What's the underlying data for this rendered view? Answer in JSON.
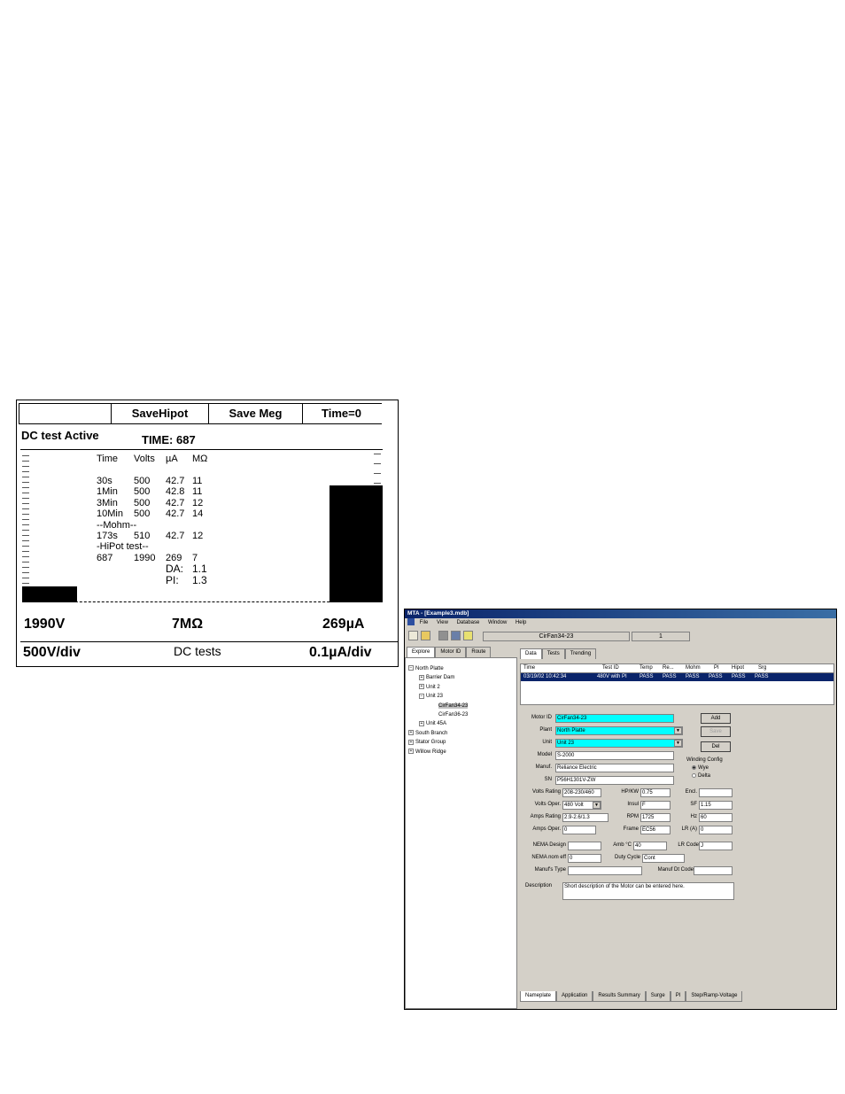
{
  "instrument": {
    "softkeys": [
      "",
      "SaveHipot",
      "Save Meg",
      "Time=0"
    ],
    "status": "DC test Active",
    "time_label": "TIME: 687",
    "columns": [
      "Time",
      "Volts",
      "µA",
      "MΩ"
    ],
    "rows": [
      [
        "30s",
        "500",
        "42.7",
        "11"
      ],
      [
        "1Min",
        "500",
        "42.8",
        "11"
      ],
      [
        "3Min",
        "500",
        "42.7",
        "12"
      ],
      [
        "10Min",
        "500",
        "42.7",
        "14"
      ],
      [
        "--Mohm--",
        "",
        "",
        ""
      ],
      [
        "173s",
        "510",
        "42.7",
        "12"
      ],
      [
        "-HiPot test--",
        "",
        "",
        ""
      ],
      [
        "687",
        "1990",
        "269",
        "7"
      ],
      [
        "",
        "",
        "DA:",
        "1.1"
      ],
      [
        "",
        "",
        "PI:",
        "1.3"
      ]
    ],
    "readout_voltage": "1990V",
    "readout_resistance": "7MΩ",
    "readout_current": "269µA",
    "scale_voltage": "500V/div",
    "mode": "DC tests",
    "scale_current": "0.1µA/div"
  },
  "mta": {
    "title": "MTA - [Example3.mdb]",
    "menu": [
      "File",
      "View",
      "Database",
      "Window",
      "Help"
    ],
    "toolbar_motor": "CirFan34-23",
    "toolbar_index": "1",
    "left_tabs": [
      "Explore",
      "Motor ID",
      "Route"
    ],
    "tree": [
      {
        "label": "North Platte",
        "indent": 0,
        "exp": "-"
      },
      {
        "label": "Barrier Dam",
        "indent": 1,
        "exp": "+"
      },
      {
        "label": "Unit 2",
        "indent": 1,
        "exp": "+"
      },
      {
        "label": "Unit 23",
        "indent": 1,
        "exp": "-"
      },
      {
        "label": "CirFan34-23",
        "indent": 3,
        "exp": ""
      },
      {
        "label": "CirFan36-23",
        "indent": 3,
        "exp": ""
      },
      {
        "label": "Unit 45A",
        "indent": 1,
        "exp": "+"
      },
      {
        "label": "South Branch",
        "indent": 0,
        "exp": "+"
      },
      {
        "label": "Stator Group",
        "indent": 0,
        "exp": "+"
      },
      {
        "label": "Willow Ridge",
        "indent": 0,
        "exp": "+"
      }
    ],
    "right_tabs": [
      "Data",
      "Tests",
      "Trending"
    ],
    "grid_headers": [
      "Time",
      "Test ID",
      "Temp",
      "Re...",
      "Mohm",
      "PI",
      "Hipot",
      "Srg"
    ],
    "grid_row": [
      "03/19/02 10:42:34",
      "480V with PI",
      "PASS",
      "PASS",
      "PASS",
      "PASS",
      "PASS",
      "PASS"
    ],
    "form": {
      "motor_id_label": "Motor ID",
      "motor_id": "CirFan34-23",
      "plant_label": "Plant",
      "plant": "North Platte",
      "unit_label": "Unit",
      "unit": "Unit 23",
      "model_label": "Model",
      "model": "S-2000",
      "manuf_label": "Manuf.",
      "manuf": "Reliance Electric",
      "sn_label": "SN",
      "sn": "P56H1301V-ZW",
      "add": "Add",
      "save": "Save",
      "del": "Del",
      "winding_label": "Winding Config",
      "wye": "Wye",
      "delta": "Delta",
      "volts_rating_label": "Volts Rating",
      "volts_rating": "208-230/460",
      "hpkw_label": "HP/KW",
      "hpkw": "0.75",
      "encl_label": "Encl.",
      "encl": "",
      "volts_oper_label": "Volts Oper.",
      "volts_oper": "480 Volt",
      "insul_label": "Insul",
      "insul": "F",
      "sf_label": "SF",
      "sf": "1.15",
      "amps_rating_label": "Amps Rating",
      "amps_rating": "2.9-2.6/1.3",
      "rpm_label": "RPM",
      "rpm": "1725",
      "hz_label": "Hz",
      "hz": "60",
      "amps_oper_label": "Amps Oper.",
      "amps_oper": "0",
      "frame_label": "Frame",
      "frame": "EC56",
      "lra_label": "LR (A)",
      "lra": "0",
      "nema_design_label": "NEMA Design",
      "nema_design": "",
      "amb_label": "Amb °C",
      "amb": "40",
      "lrcode_label": "LR Code",
      "lrcode": "J",
      "nema_eff_label": "NEMA nom eff",
      "nema_eff": "0",
      "duty_label": "Duty Cycle",
      "duty": "Cont",
      "manuf_type_label": "Manuf's Type",
      "manuf_type": "",
      "manuf_dtcode_label": "Manuf Dt Code",
      "manuf_dtcode": "",
      "description_label": "Description",
      "description": "Short description of the Motor can be entered here."
    },
    "bottom_tabs": [
      "Nameplate",
      "Application",
      "Results Summary",
      "Surge",
      "PI",
      "Step/Ramp-Voltage"
    ]
  }
}
